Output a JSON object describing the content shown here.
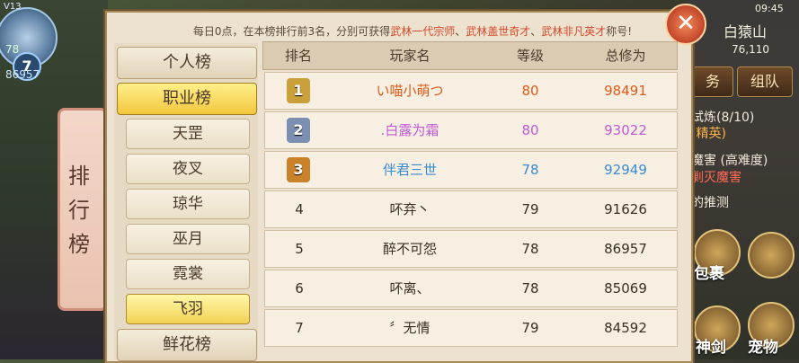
{
  "hud": {
    "version": "V13",
    "player_level": "78",
    "player_id": "86957",
    "avatar_badge": "7",
    "map_name": "白猿山",
    "coords": "76,110",
    "time": "09:45",
    "buttons": [
      "务",
      "组队"
    ],
    "quests": [
      "试炼(8/10)",
      "(精英)",
      "魔害 (高难度)",
      "剿灭魔害",
      "的推测"
    ],
    "round_buttons": [
      {
        "icon": "bag-icon",
        "label": "包裹"
      },
      {
        "icon": "sword-icon",
        "label": "神剑"
      },
      {
        "icon": "pet-icon",
        "label": "宠物"
      }
    ]
  },
  "ribbon": {
    "title_chars": [
      "排",
      "行",
      "榜"
    ]
  },
  "panel": {
    "notice_prefix": "每日0点，在本榜排行前3名，分别可获得",
    "titles": [
      "武林一代宗师",
      "武林盖世奇才",
      "武林非凡英才"
    ],
    "notice_suffix": "称号!",
    "close_symbol": "✕"
  },
  "tabs": {
    "personal": "个人榜",
    "profession": "职业榜",
    "sub": [
      "天罡",
      "夜叉",
      "琼华",
      "巫月",
      "霓裳",
      "飞羽"
    ],
    "active_sub": "飞羽",
    "next": "鲜花榜"
  },
  "table": {
    "headers": {
      "rank": "排名",
      "player": "玩家名",
      "level": "等级",
      "power": "总修为"
    },
    "rows": [
      {
        "rank": "1",
        "name": "い喵小萌つ",
        "level": "80",
        "power": "98491",
        "color": "#e05a1b",
        "medal": "#caa03a"
      },
      {
        "rank": "2",
        "name": ".白露为霜",
        "level": "80",
        "power": "93022",
        "color": "#c25ad6",
        "medal": "#7d8fb0"
      },
      {
        "rank": "3",
        "name": "伴君三世",
        "level": "78",
        "power": "92949",
        "color": "#3a8ad0",
        "medal": "#c9822a"
      },
      {
        "rank": "4",
        "name": "吥弃丶",
        "level": "79",
        "power": "91626",
        "color": "#3a2f22"
      },
      {
        "rank": "5",
        "name": "醉不可怨",
        "level": "78",
        "power": "86957",
        "color": "#3a2f22"
      },
      {
        "rank": "6",
        "name": "吥离、",
        "level": "78",
        "power": "85069",
        "color": "#3a2f22"
      },
      {
        "rank": "7",
        "name": "〞无情",
        "level": "79",
        "power": "84592",
        "color": "#3a2f22"
      }
    ]
  }
}
